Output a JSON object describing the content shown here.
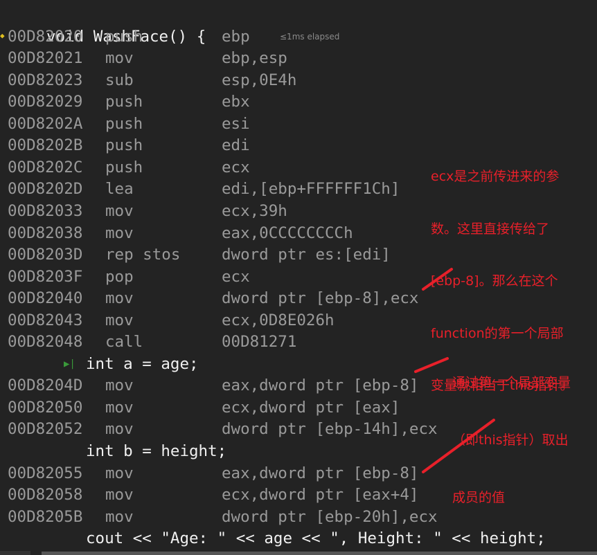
{
  "function_header": "void WashFace() {",
  "elapsed_hint": "≤1ms elapsed",
  "lines": [
    {
      "type": "asm",
      "addr": "00D82020",
      "mnemonic": "push",
      "operand": "ebp"
    },
    {
      "type": "asm",
      "addr": "00D82021",
      "mnemonic": "mov",
      "operand": "ebp,esp"
    },
    {
      "type": "asm",
      "addr": "00D82023",
      "mnemonic": "sub",
      "operand": "esp,0E4h"
    },
    {
      "type": "asm",
      "addr": "00D82029",
      "mnemonic": "push",
      "operand": "ebx"
    },
    {
      "type": "asm",
      "addr": "00D8202A",
      "mnemonic": "push",
      "operand": "esi"
    },
    {
      "type": "asm",
      "addr": "00D8202B",
      "mnemonic": "push",
      "operand": "edi"
    },
    {
      "type": "asm",
      "addr": "00D8202C",
      "mnemonic": "push",
      "operand": "ecx"
    },
    {
      "type": "asm",
      "addr": "00D8202D",
      "mnemonic": "lea",
      "operand": "edi,[ebp+FFFFFF1Ch]"
    },
    {
      "type": "asm",
      "addr": "00D82033",
      "mnemonic": "mov",
      "operand": "ecx,39h"
    },
    {
      "type": "asm",
      "addr": "00D82038",
      "mnemonic": "mov",
      "operand": "eax,0CCCCCCCCh"
    },
    {
      "type": "asm",
      "addr": "00D8203D",
      "mnemonic": "rep stos",
      "operand": "dword ptr es:[edi]"
    },
    {
      "type": "asm",
      "addr": "00D8203F",
      "mnemonic": "pop",
      "operand": "ecx"
    },
    {
      "type": "asm",
      "addr": "00D82040",
      "mnemonic": "mov",
      "operand": "dword ptr [ebp-8],ecx"
    },
    {
      "type": "asm",
      "addr": "00D82043",
      "mnemonic": "mov",
      "operand": "ecx,0D8E026h"
    },
    {
      "type": "asm",
      "addr": "00D82048",
      "mnemonic": "call",
      "operand": "00D81271"
    },
    {
      "type": "src",
      "text": "int a = age;",
      "current": true
    },
    {
      "type": "asm",
      "addr": "00D8204D",
      "mnemonic": "mov",
      "operand": "eax,dword ptr [ebp-8]"
    },
    {
      "type": "asm",
      "addr": "00D82050",
      "mnemonic": "mov",
      "operand": "ecx,dword ptr [eax]"
    },
    {
      "type": "asm",
      "addr": "00D82052",
      "mnemonic": "mov",
      "operand": "dword ptr [ebp-14h],ecx"
    },
    {
      "type": "src",
      "text": "int b = height;"
    },
    {
      "type": "asm",
      "addr": "00D82055",
      "mnemonic": "mov",
      "operand": "eax,dword ptr [ebp-8]"
    },
    {
      "type": "asm",
      "addr": "00D82058",
      "mnemonic": "mov",
      "operand": "ecx,dword ptr [eax+4]"
    },
    {
      "type": "asm",
      "addr": "00D8205B",
      "mnemonic": "mov",
      "operand": "dword ptr [ebp-20h],ecx"
    },
    {
      "type": "src",
      "text": "cout << \"Age: \" << age << \", Height: \" << height;"
    }
  ],
  "annotations": {
    "note1": [
      "ecx是之前传进来的参",
      "数。这里直接传给了",
      "[ebp-8]。那么在这个",
      "function的第一个局部",
      "变量就相当于this指针。"
    ],
    "note2": [
      "通过第一个局部变量",
      "（即this指针）取出",
      "成员的值"
    ],
    "color": "#e8202a"
  }
}
